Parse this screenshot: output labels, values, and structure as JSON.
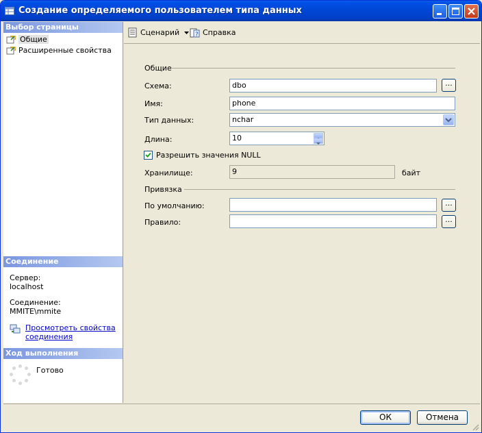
{
  "window": {
    "title": "Создание определяемого пользователем типа данных"
  },
  "left": {
    "select_page_header": "Выбор страницы",
    "pages": [
      {
        "label": "Общие",
        "icon": "page-icon",
        "selected": true
      },
      {
        "label": "Расширенные свойства",
        "icon": "page-icon",
        "selected": false
      }
    ],
    "connection_header": "Соединение",
    "server_label": "Сервер:",
    "server_value": "localhost",
    "connection_label": "Соединение:",
    "connection_value": "MMITE\\mmite",
    "view_props_link_line1": "Просмотреть свойства",
    "view_props_link_line2": "соединения",
    "progress_header": "Ход выполнения",
    "progress_status": "Готово"
  },
  "toolbar": {
    "script_label": "Сценарий",
    "help_label": "Справка"
  },
  "form": {
    "general_group": "Общие",
    "schema_label": "Схема:",
    "schema_value": "dbo",
    "name_label": "Имя:",
    "name_value": "phone",
    "datatype_label": "Тип данных:",
    "datatype_value": "nchar",
    "length_label": "Длина:",
    "length_value": "10",
    "allow_null_label": "Разрешить значения NULL",
    "allow_null_checked": true,
    "storage_label": "Хранилище:",
    "storage_value": "9",
    "storage_unit": "байт",
    "binding_group": "Привязка",
    "default_label": "По умолчанию:",
    "default_value": "",
    "rule_label": "Правило:",
    "rule_value": "",
    "browse_label": "..."
  },
  "buttons": {
    "ok": "ОК",
    "cancel": "Отмена"
  }
}
